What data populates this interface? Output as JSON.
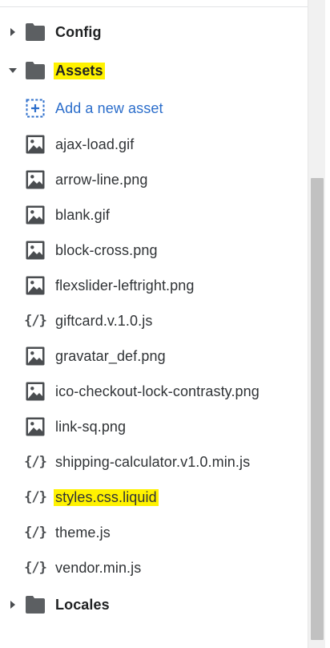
{
  "folders": {
    "config": {
      "label": "Config",
      "expanded": false
    },
    "assets": {
      "label": "Assets",
      "expanded": true,
      "highlighted": true
    },
    "locales": {
      "label": "Locales",
      "expanded": false
    }
  },
  "assets": {
    "add_label": "Add a new asset",
    "files": [
      {
        "name": "ajax-load.gif",
        "icon": "image-icon"
      },
      {
        "name": "arrow-line.png",
        "icon": "image-icon"
      },
      {
        "name": "blank.gif",
        "icon": "image-icon"
      },
      {
        "name": "block-cross.png",
        "icon": "image-icon"
      },
      {
        "name": "flexslider-leftright.png",
        "icon": "image-icon"
      },
      {
        "name": "giftcard.v.1.0.js",
        "icon": "code-icon"
      },
      {
        "name": "gravatar_def.png",
        "icon": "image-icon"
      },
      {
        "name": "ico-checkout-lock-contrasty.png",
        "icon": "image-icon"
      },
      {
        "name": "link-sq.png",
        "icon": "image-icon"
      },
      {
        "name": "shipping-calculator.v1.0.min.js",
        "icon": "code-icon"
      },
      {
        "name": "styles.css.liquid",
        "icon": "code-icon",
        "highlighted": true
      },
      {
        "name": "theme.js",
        "icon": "code-icon"
      },
      {
        "name": "vendor.min.js",
        "icon": "code-icon"
      }
    ]
  },
  "icons": {
    "code_glyph": "{/}"
  },
  "colors": {
    "highlight": "#fff200",
    "link": "#2c6ecb",
    "icon": "#4a4d50",
    "scroll_thumb": "#c1c1c1"
  }
}
